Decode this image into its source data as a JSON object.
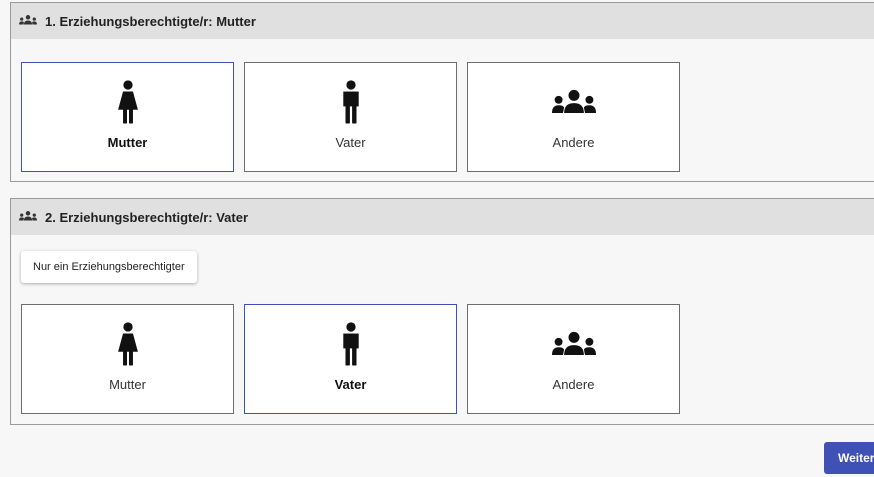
{
  "section1": {
    "title": "1. Erziehungsberechtigte/r: Mutter",
    "header_icon": "group-icon",
    "options": [
      {
        "label": "Mutter",
        "icon": "female-icon",
        "selected": true
      },
      {
        "label": "Vater",
        "icon": "male-icon",
        "selected": false
      },
      {
        "label": "Andere",
        "icon": "group-icon",
        "selected": false
      }
    ]
  },
  "section2": {
    "title": "2. Erziehungsberechtigte/r: Vater",
    "header_icon": "group-icon",
    "single_parent_button": "Nur ein Erziehungsberechtigter",
    "options": [
      {
        "label": "Mutter",
        "icon": "female-icon",
        "selected": false
      },
      {
        "label": "Vater",
        "icon": "male-icon",
        "selected": true
      },
      {
        "label": "Andere",
        "icon": "group-icon",
        "selected": false
      }
    ]
  },
  "footer": {
    "next_label": "Weiter"
  },
  "colors": {
    "accent": "#3f51b5",
    "header_bg": "#e0e0e0"
  }
}
